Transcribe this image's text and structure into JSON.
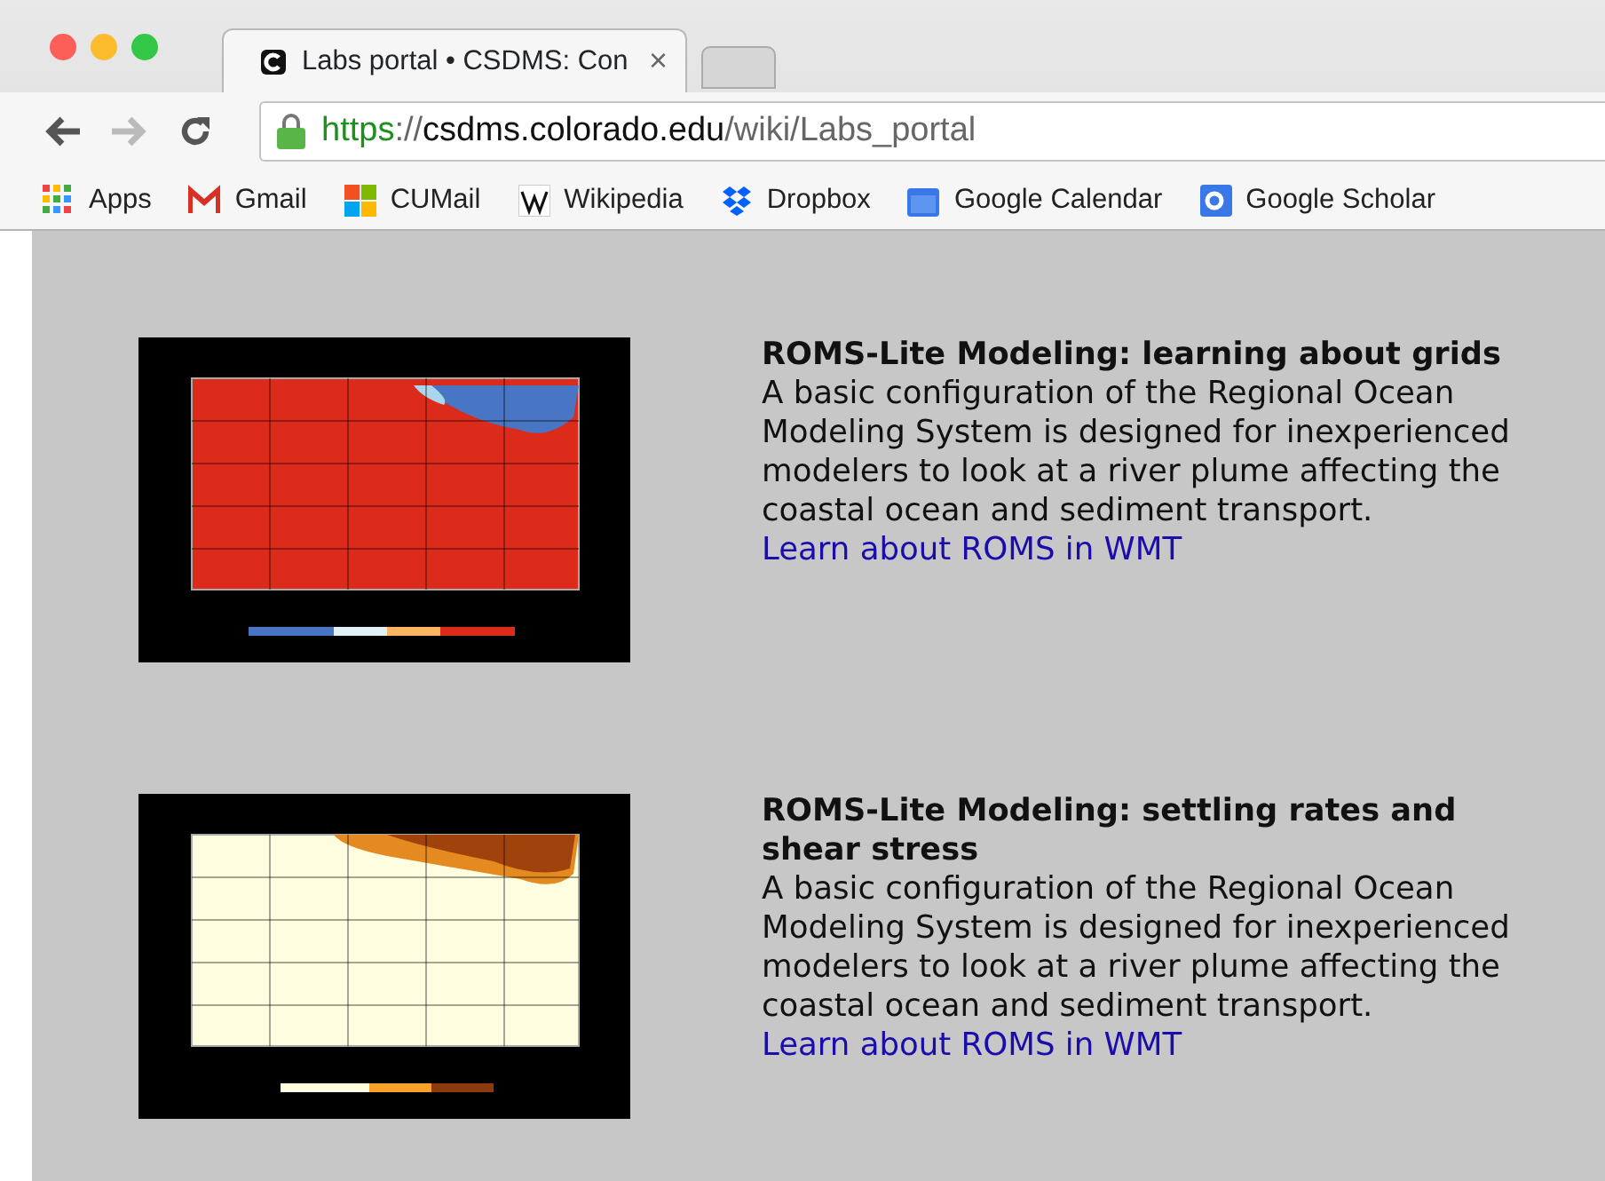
{
  "browser": {
    "tab": {
      "title": "Labs portal • CSDMS: Con",
      "close": "×",
      "selected": true
    },
    "address": {
      "scheme": "https",
      "separator": "://",
      "host": "csdms.colorado.edu",
      "path": "/wiki/Labs_portal"
    },
    "bookmarks": [
      {
        "label": "Apps"
      },
      {
        "label": "Gmail"
      },
      {
        "label": "CUMail"
      },
      {
        "label": "Wikipedia"
      },
      {
        "label": "Dropbox"
      },
      {
        "label": "Google Calendar"
      },
      {
        "label": "Google Scholar"
      }
    ]
  },
  "labs": [
    {
      "title": "ROMS-Lite Modeling: learning about grids",
      "description": "A basic configuration of the Regional Ocean Modeling System is designed for inexperienced modelers to look at a river plume affecting the coastal ocean and sediment transport.",
      "link": "Learn about ROMS in WMT"
    },
    {
      "title": "ROMS-Lite Modeling: settling rates and shear stress",
      "description": "A basic configuration of the Regional Ocean Modeling System is designed for inexperienced modelers to look at a river plume affecting the coastal ocean and sediment transport.",
      "link": "Learn about ROMS in WMT"
    }
  ]
}
